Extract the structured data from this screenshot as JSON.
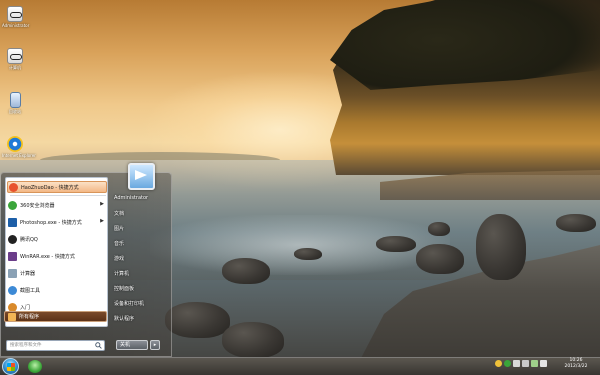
{
  "desktop_icons": [
    {
      "name": "desktop-icon-1",
      "label": "Administrator",
      "icon": "glasses-icon"
    },
    {
      "name": "desktop-icon-2",
      "label": "计算机",
      "icon": "glasses-icon"
    },
    {
      "name": "desktop-icon-3",
      "label": "回收站",
      "icon": "recycle-bin-icon"
    },
    {
      "name": "desktop-icon-4",
      "label": "Internet Explorer",
      "icon": "ie-icon"
    }
  ],
  "start_menu": {
    "left_items": [
      {
        "label": "HaoZhuoDao - 快捷方式",
        "icon_color": "#e8532d",
        "highlighted": true,
        "arrow": false
      },
      {
        "label": "360安全浏览器",
        "icon_color": "#3aa53a",
        "highlighted": false,
        "arrow": true
      },
      {
        "label": "Photoshop.exe - 快捷方式",
        "icon_color": "#1d5fa8",
        "highlighted": false,
        "arrow": true
      },
      {
        "label": "腾讯QQ",
        "icon_color": "#222222",
        "highlighted": false,
        "arrow": false
      },
      {
        "label": "WinRAR.exe - 快捷方式",
        "icon_color": "#6b3d8a",
        "highlighted": false,
        "arrow": false
      },
      {
        "label": "计算器",
        "icon_color": "#8aa1b5",
        "highlighted": false,
        "arrow": false
      },
      {
        "label": "截图工具",
        "icon_color": "#3d8ad6",
        "highlighted": false,
        "arrow": false
      },
      {
        "label": "入门",
        "icon_color": "#d98a2b",
        "highlighted": false,
        "arrow": false
      }
    ],
    "all_programs_label": "所有程序",
    "search_placeholder": "搜索程序和文件",
    "right_items": [
      "Administrator",
      "文档",
      "图片",
      "音乐",
      "游戏",
      "计算机",
      "控制面板",
      "设备和打印机",
      "默认程序"
    ],
    "shutdown_label": "关机"
  },
  "taskbar": {
    "time": "10:26",
    "date": "2012/3/22",
    "tray_icons": [
      "qq-icon",
      "security-icon",
      "network-icon",
      "volume-icon",
      "battery-icon",
      "flag-icon"
    ]
  },
  "colors": {
    "accent": "#f3b886",
    "taskbar": "#4a4640"
  }
}
